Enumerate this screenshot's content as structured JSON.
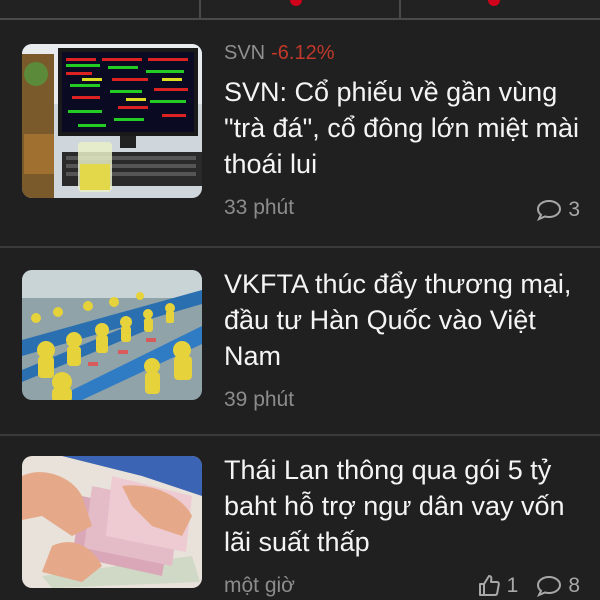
{
  "articles": [
    {
      "ticker": "SVN",
      "change": "-6.12%",
      "title_lines": [
        "SVN: Cổ phiếu về gần vùng",
        "\"trà đá\", cổ đông lớn miệt mài",
        "thoái lui"
      ],
      "time": "33 phút",
      "comments": "3",
      "likes": "",
      "image": "stock-monitor-desk-icon"
    },
    {
      "title_lines": [
        "VKFTA thúc đẩy thương mại,",
        "đầu tư Hàn Quốc vào Việt",
        "Nam"
      ],
      "time": "39 phút",
      "image": "factory-workers-icon"
    },
    {
      "title_lines": [
        "Thái Lan thông qua gói 5 tỷ",
        "baht hỗ trợ ngư dân vay vốn",
        "lãi suất thấp"
      ],
      "time": "một giờ",
      "likes": "1",
      "comments": "8",
      "image": "counting-money-icon"
    }
  ],
  "colors": {
    "background": "#202020",
    "title": "#f4f4f4",
    "muted": "#8c8c8c",
    "negative": "#c0392b",
    "accent": "#d0021b"
  }
}
